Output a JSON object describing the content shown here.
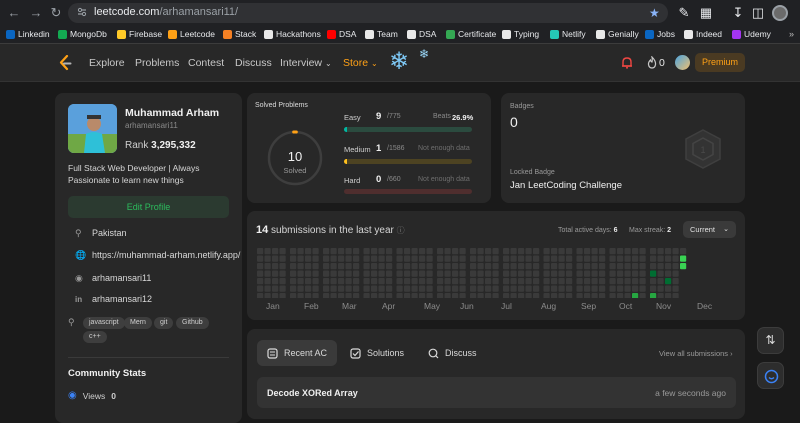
{
  "browser": {
    "url_host": "leetcode.com",
    "url_path": "/arhamansari11/",
    "bookmarks": [
      {
        "label": "Linkedin",
        "color": "#0a66c2"
      },
      {
        "label": "MongoDb",
        "color": "#13aa52"
      },
      {
        "label": "Firebase",
        "color": "#ffca28"
      },
      {
        "label": "Leetcode",
        "color": "#ffa116"
      },
      {
        "label": "Stack",
        "color": "#f48024"
      },
      {
        "label": "Hackathons",
        "color": "#e8e8e8"
      },
      {
        "label": "DSA",
        "color": "#ff0000"
      },
      {
        "label": "Team",
        "color": "#e8e8e8"
      },
      {
        "label": "DSA",
        "color": "#e8e8e8"
      },
      {
        "label": "Certificate",
        "color": "#34a853"
      },
      {
        "label": "Typing",
        "color": "#e8e8e8"
      },
      {
        "label": "Netlify",
        "color": "#25c7b7"
      },
      {
        "label": "Genially",
        "color": "#e8e8e8"
      },
      {
        "label": "Jobs",
        "color": "#0a66c2"
      },
      {
        "label": "Indeed",
        "color": "#e8e8e8"
      },
      {
        "label": "Udemy",
        "color": "#a435f0"
      }
    ]
  },
  "nav": {
    "explore": "Explore",
    "problems": "Problems",
    "contest": "Contest",
    "discuss": "Discuss",
    "interview": "Interview",
    "store": "Store",
    "notifications_count": "0",
    "premium": "Premium"
  },
  "profile": {
    "name": "Muhammad Arham",
    "username": "arhamansari11",
    "rank_label": "Rank",
    "rank": "3,295,332",
    "bio": "Full Stack Web Developer | Always Passionate to learn new things",
    "edit_label": "Edit Profile",
    "location": "Pakistan",
    "website": "https://muhammad-arham.netlify.app/",
    "github": "arhamansari11",
    "linkedin": "arhamansari12",
    "tags": [
      "javascript",
      "Mern",
      "git",
      "Github",
      "c++"
    ],
    "community_title": "Community Stats",
    "views_label": "Views",
    "views": "0"
  },
  "solved": {
    "title": "Solved Problems",
    "count": "10",
    "count_label": "Solved",
    "beats_label": "Beats",
    "beats": "26.9%",
    "easy": {
      "label": "Easy",
      "solved": "9",
      "total": "/775"
    },
    "medium": {
      "label": "Medium",
      "solved": "1",
      "total": "/1586",
      "note": "Not enough data"
    },
    "hard": {
      "label": "Hard",
      "solved": "0",
      "total": "/660",
      "note": "Not enough data"
    },
    "easy_fraction": 0.0116,
    "medium_fraction": 0.0006,
    "hard_fraction": 0,
    "colors": {
      "easy": "#00b8a3",
      "medium": "#ffc01e",
      "hard": "#ef4743"
    }
  },
  "badges": {
    "title": "Badges",
    "count": "0",
    "locked_label": "Locked Badge",
    "locked_name": "Jan LeetCoding Challenge"
  },
  "submissions": {
    "count": "14",
    "text": "submissions in the last year",
    "active_days_label": "Total active days:",
    "active_days": "6",
    "max_streak_label": "Max streak:",
    "max_streak": "2",
    "period": "Current",
    "months": [
      "Jan",
      "Feb",
      "Mar",
      "Apr",
      "May",
      "Jun",
      "Jul",
      "Aug",
      "Sep",
      "Oct",
      "Nov",
      "Dec"
    ]
  },
  "recent": {
    "tabs": {
      "recent_ac": "Recent AC",
      "solutions": "Solutions",
      "discuss": "Discuss"
    },
    "view_all": "View all submissions",
    "items": [
      {
        "title": "Decode XORed Array",
        "time": "a few seconds ago"
      }
    ]
  }
}
